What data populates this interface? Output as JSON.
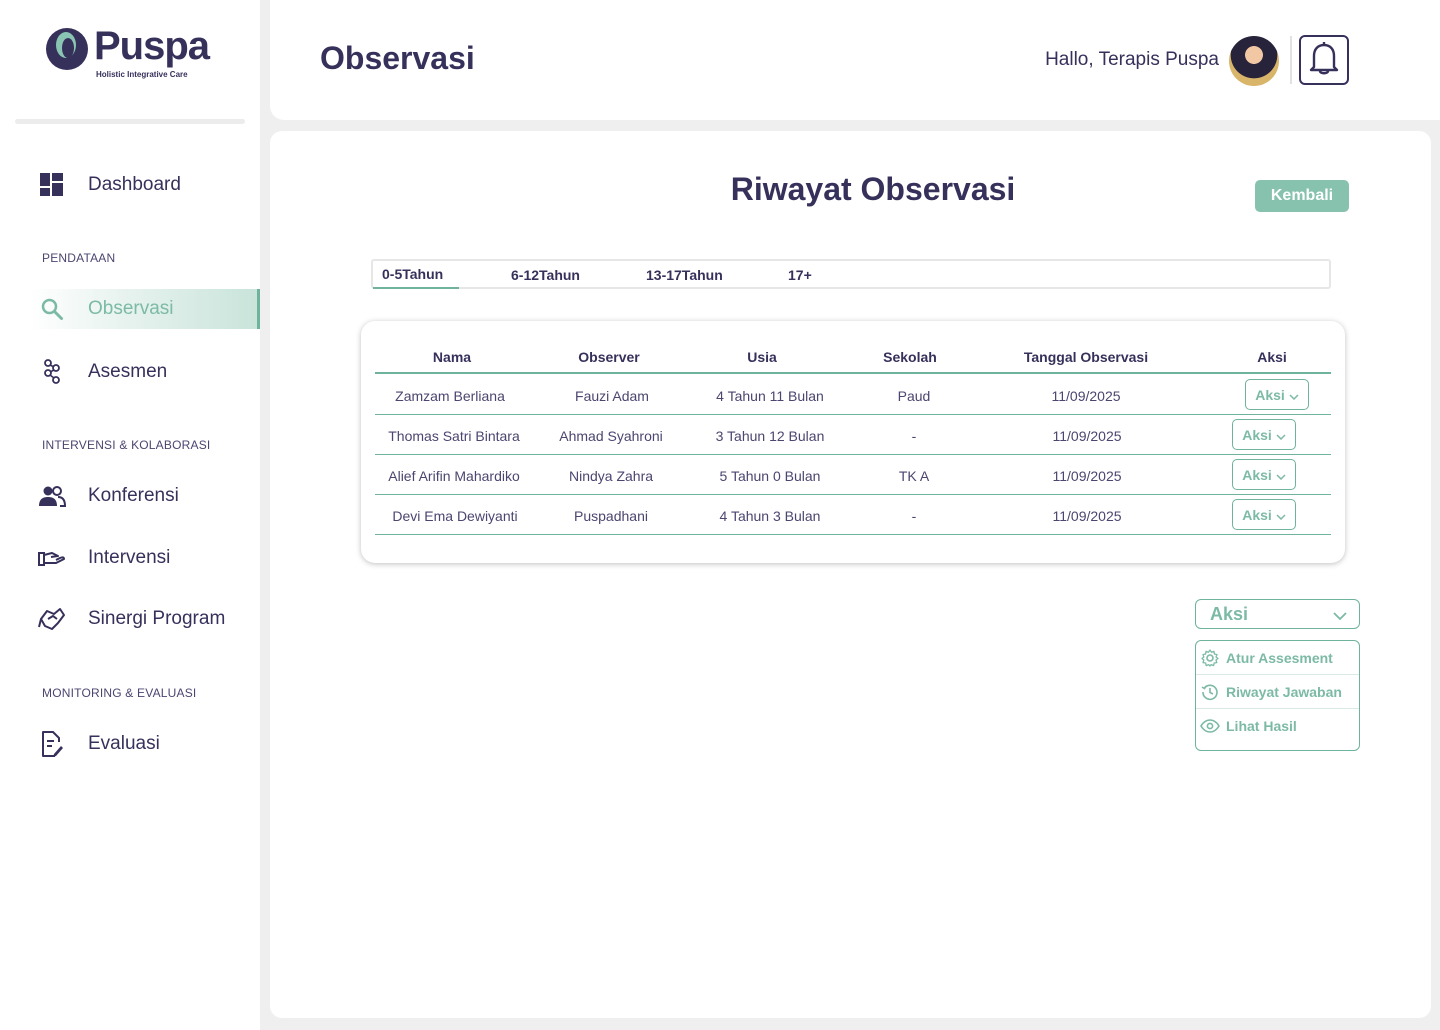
{
  "brand": {
    "name": "Puspa",
    "tagline": "Holistic Integrative Care",
    "accent": "#86c2ae",
    "primary": "#36315b"
  },
  "sidebar": {
    "dashboard": {
      "label": "Dashboard",
      "icon": "dashboard-icon"
    },
    "sections": [
      {
        "label": "PENDATAAN"
      },
      {
        "label": "INTERVENSI & KOLABORASI"
      },
      {
        "label": "MONITORING & EVALUASI"
      }
    ],
    "items": [
      {
        "label": "Observasi",
        "icon": "search-icon",
        "active": true
      },
      {
        "label": "Asesmen",
        "icon": "assessment-icon"
      },
      {
        "label": "Konferensi",
        "icon": "users-icon"
      },
      {
        "label": "Intervensi",
        "icon": "hand-icon"
      },
      {
        "label": "Sinergi Program",
        "icon": "handshake-icon"
      },
      {
        "label": "Evaluasi",
        "icon": "document-edit-icon"
      }
    ]
  },
  "header": {
    "title": "Observasi",
    "greeting": "Hallo, Terapis Puspa",
    "notification_icon": "bell-icon"
  },
  "main": {
    "title": "Riwayat Observasi",
    "back_label": "Kembali",
    "tabs": [
      {
        "label": "0-5Tahun",
        "active": true
      },
      {
        "label": "6-12Tahun"
      },
      {
        "label": "13-17Tahun"
      },
      {
        "label": "17+"
      }
    ],
    "table": {
      "columns": [
        "Nama",
        "Observer",
        "Usia",
        "Sekolah",
        "Tanggal Observasi",
        "Aksi"
      ],
      "rows": [
        {
          "nama": "Zamzam Berliana",
          "observer": "Fauzi Adam",
          "usia": "4 Tahun 11 Bulan",
          "sekolah": "Paud",
          "tanggal": "11/09/2025",
          "aksi": "Aksi"
        },
        {
          "nama": "Thomas Satri Bintara",
          "observer": "Ahmad Syahroni",
          "usia": "3 Tahun 12 Bulan",
          "sekolah": "-",
          "tanggal": "11/09/2025",
          "aksi": "Aksi"
        },
        {
          "nama": "Alief Arifin Mahardiko",
          "observer": "Nindya Zahra",
          "usia": "5 Tahun 0 Bulan",
          "sekolah": "TK A",
          "tanggal": "11/09/2025",
          "aksi": "Aksi"
        },
        {
          "nama": "Devi Ema Dewiyanti",
          "observer": "Puspadhani",
          "usia": "4 Tahun 3 Bulan",
          "sekolah": "-",
          "tanggal": "11/09/2025",
          "aksi": "Aksi"
        }
      ]
    },
    "dropdown": {
      "label": "Aksi",
      "items": [
        {
          "label": "Atur Assesment",
          "icon": "gear-icon"
        },
        {
          "label": "Riwayat Jawaban",
          "icon": "history-icon"
        },
        {
          "label": "Lihat Hasil",
          "icon": "eye-icon"
        }
      ]
    }
  }
}
